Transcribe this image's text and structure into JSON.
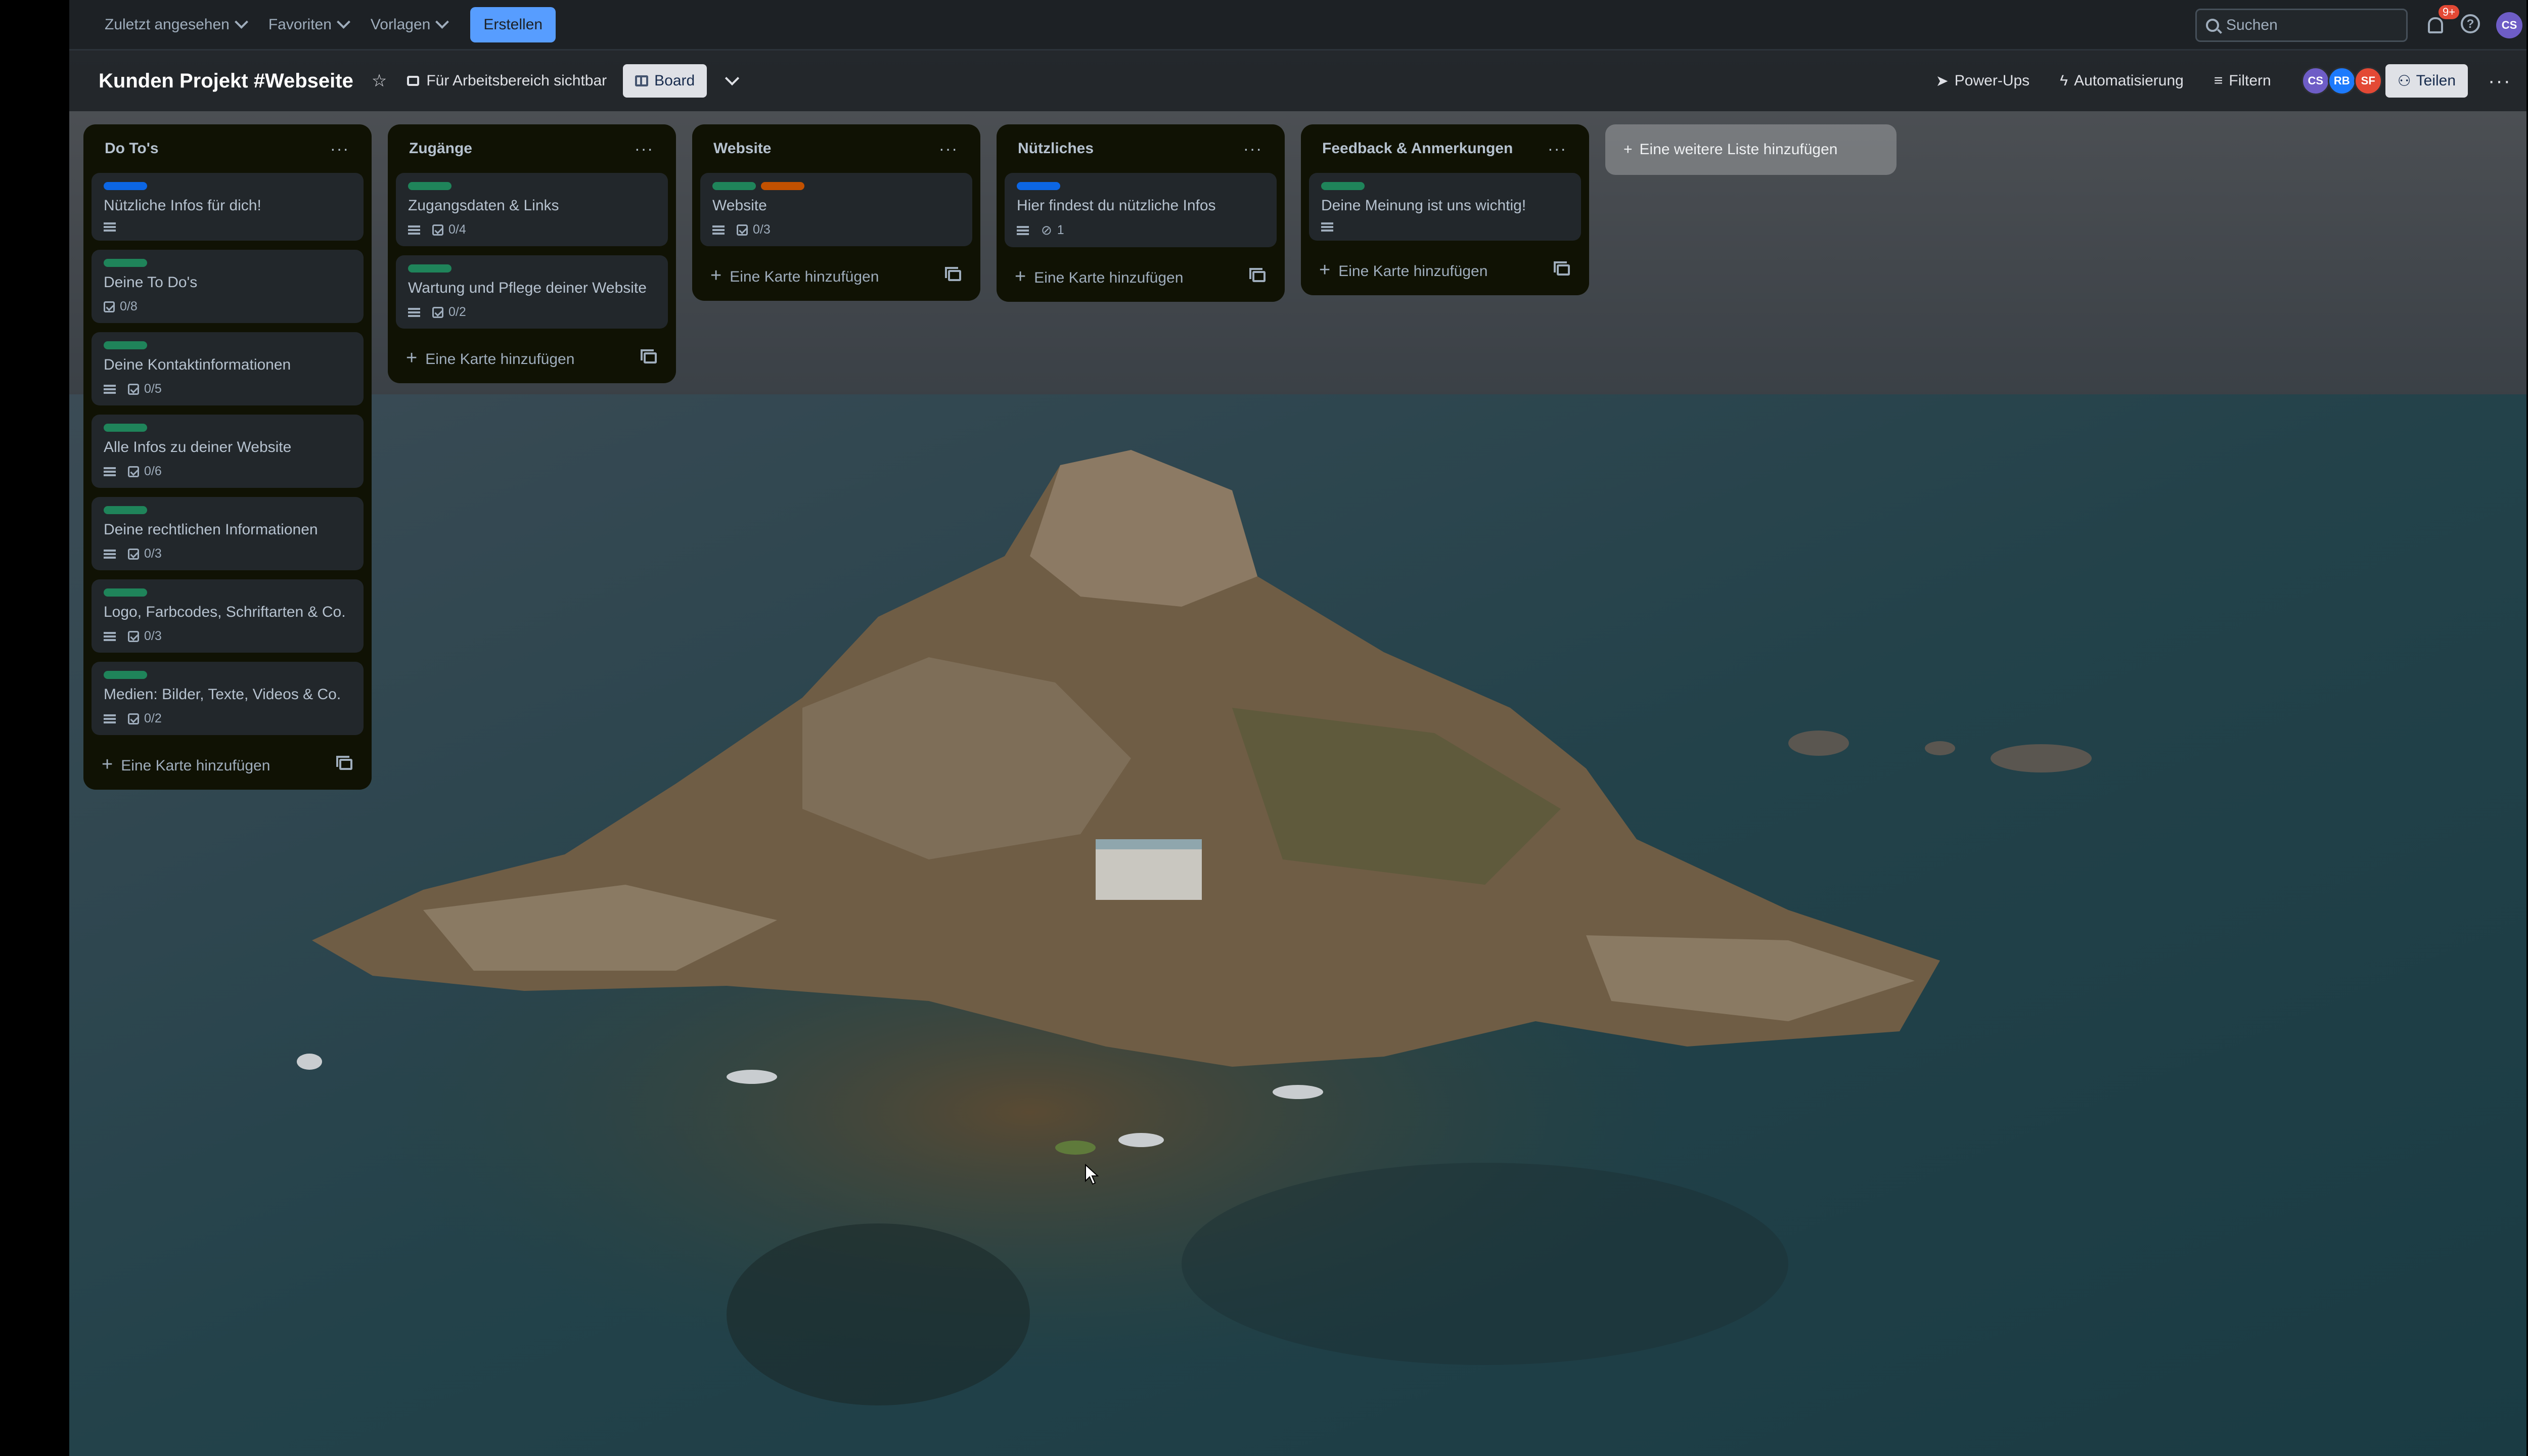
{
  "topnav": {
    "menus": [
      "Zuletzt angesehen",
      "Favoriten",
      "Vorlagen"
    ],
    "create_label": "Erstellen",
    "search_placeholder": "Suchen",
    "notifications_badge": "9+",
    "user_initials": "CS"
  },
  "board": {
    "title": "Kunden Projekt #Webseite",
    "visibility": "Für Arbeitsbereich sichtbar",
    "view_label": "Board",
    "powerups": "Power-Ups",
    "automation": "Automatisierung",
    "filter": "Filtern",
    "share": "Teilen",
    "members": [
      {
        "initials": "CS",
        "color": "#6e5dc6"
      },
      {
        "initials": "RB",
        "color": "#1d7afc"
      },
      {
        "initials": "SF",
        "color": "#e34935"
      }
    ]
  },
  "colors": {
    "label_blue": "#0c66e4",
    "label_green": "#1f845a",
    "label_orange": "#c25100"
  },
  "add_card_label": "Eine Karte hinzufügen",
  "add_list_label": "Eine weitere Liste hinzufügen",
  "lists": [
    {
      "title": "Do To's",
      "cards": [
        {
          "title": "Nützliche Infos für dich!",
          "labels": [
            "blue"
          ],
          "desc": true,
          "checklist": null,
          "attachments": null
        },
        {
          "title": "Deine To Do's",
          "labels": [
            "green"
          ],
          "desc": false,
          "checklist": "0/8",
          "attachments": null
        },
        {
          "title": "Deine Kontaktinformationen",
          "labels": [
            "green"
          ],
          "desc": true,
          "checklist": "0/5",
          "attachments": null
        },
        {
          "title": "Alle Infos zu deiner Website",
          "labels": [
            "green"
          ],
          "desc": true,
          "checklist": "0/6",
          "attachments": null
        },
        {
          "title": "Deine rechtlichen Informationen",
          "labels": [
            "green"
          ],
          "desc": true,
          "checklist": "0/3",
          "attachments": null
        },
        {
          "title": "Logo, Farbcodes, Schriftarten & Co.",
          "labels": [
            "green"
          ],
          "desc": true,
          "checklist": "0/3",
          "attachments": null
        },
        {
          "title": "Medien: Bilder, Texte, Videos & Co.",
          "labels": [
            "green"
          ],
          "desc": true,
          "checklist": "0/2",
          "attachments": null
        }
      ]
    },
    {
      "title": "Zugänge",
      "cards": [
        {
          "title": "Zugangsdaten & Links",
          "labels": [
            "green"
          ],
          "desc": true,
          "checklist": "0/4",
          "attachments": null
        },
        {
          "title": "Wartung und Pflege deiner Website",
          "labels": [
            "green"
          ],
          "desc": true,
          "checklist": "0/2",
          "attachments": null
        }
      ]
    },
    {
      "title": "Website",
      "cards": [
        {
          "title": "Website",
          "labels": [
            "green",
            "orange"
          ],
          "desc": true,
          "checklist": "0/3",
          "attachments": null
        }
      ]
    },
    {
      "title": "Nützliches",
      "cards": [
        {
          "title": "Hier findest du nützliche Infos",
          "labels": [
            "blue"
          ],
          "desc": true,
          "checklist": null,
          "attachments": "1"
        }
      ]
    },
    {
      "title": "Feedback & Anmerkungen",
      "cards": [
        {
          "title": "Deine Meinung ist uns wichtig!",
          "labels": [
            "green"
          ],
          "desc": true,
          "checklist": null,
          "attachments": null
        }
      ]
    }
  ]
}
